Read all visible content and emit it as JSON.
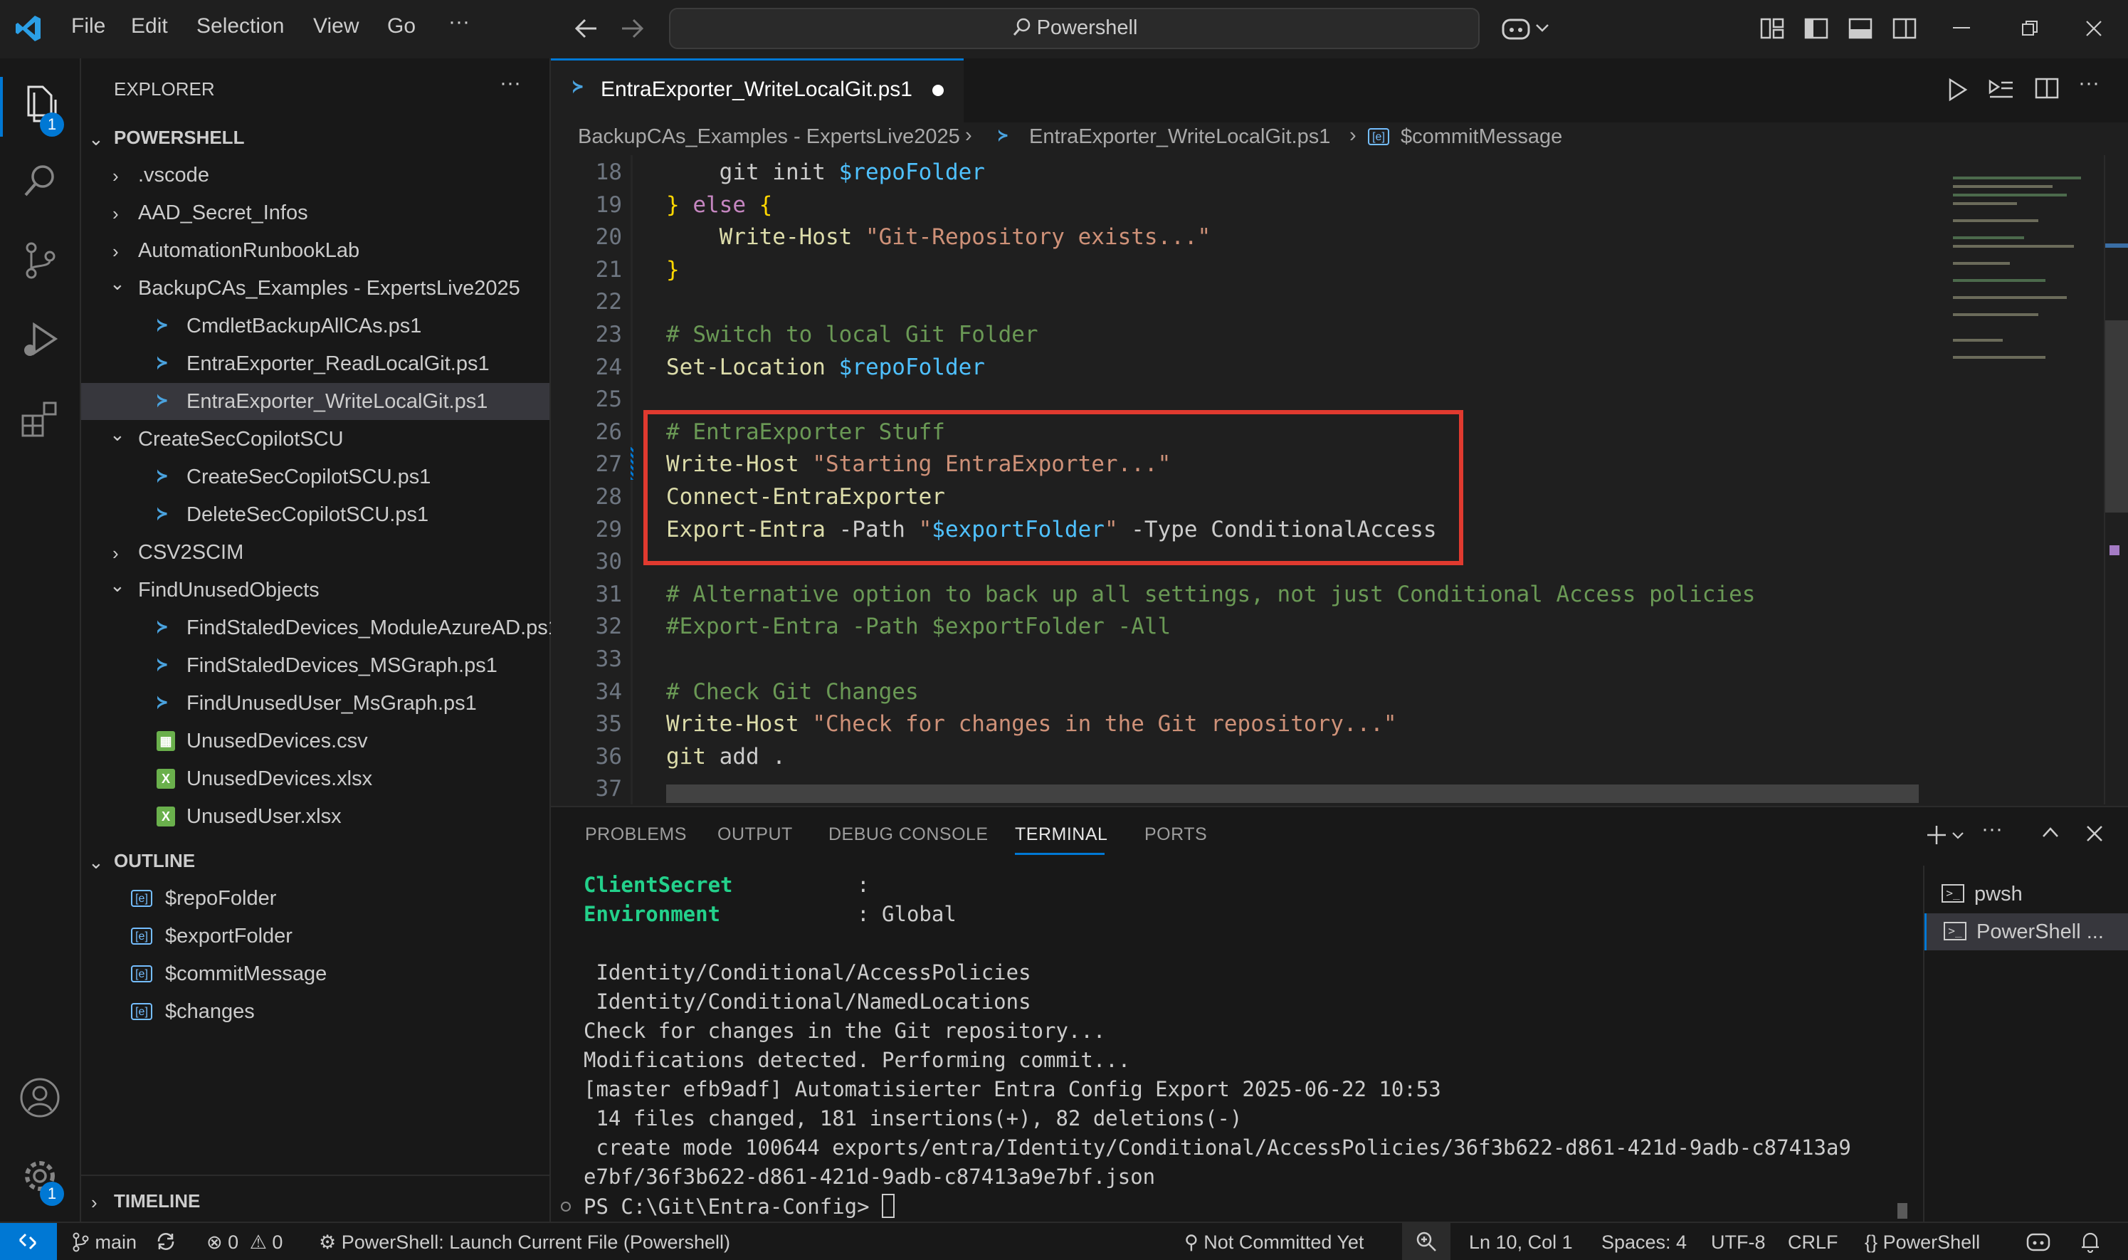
{
  "titlebar": {
    "menu": [
      "File",
      "Edit",
      "Selection",
      "View",
      "Go",
      "···"
    ],
    "search": "Powershell"
  },
  "activity": {
    "explorer_badge": "1",
    "settings_badge": "1"
  },
  "sidebar": {
    "title": "EXPLORER",
    "more": "···",
    "root": "POWERSHELL",
    "items": [
      {
        "label": ".vscode",
        "kind": "folder-closed"
      },
      {
        "label": "AAD_Secret_Infos",
        "kind": "folder-closed"
      },
      {
        "label": "AutomationRunbookLab",
        "kind": "folder-closed"
      },
      {
        "label": "BackupCAs_Examples - ExpertsLive2025",
        "kind": "folder-open"
      },
      {
        "label": "CmdletBackupAllCAs.ps1",
        "kind": "ps"
      },
      {
        "label": "EntraExporter_ReadLocalGit.ps1",
        "kind": "ps"
      },
      {
        "label": "EntraExporter_WriteLocalGit.ps1",
        "kind": "ps"
      },
      {
        "label": "CreateSecCopilotSCU",
        "kind": "folder-open"
      },
      {
        "label": "CreateSecCopilotSCU.ps1",
        "kind": "ps"
      },
      {
        "label": "DeleteSecCopilotSCU.ps1",
        "kind": "ps"
      },
      {
        "label": "CSV2SCIM",
        "kind": "folder-closed"
      },
      {
        "label": "FindUnusedObjects",
        "kind": "folder-open"
      },
      {
        "label": "FindStaledDevices_ModuleAzureAD.ps1",
        "kind": "ps"
      },
      {
        "label": "FindStaledDevices_MSGraph.ps1",
        "kind": "ps"
      },
      {
        "label": "FindUnusedUser_MsGraph.ps1",
        "kind": "ps"
      },
      {
        "label": "UnusedDevices.csv",
        "kind": "csv"
      },
      {
        "label": "UnusedDevices.xlsx",
        "kind": "xlsx"
      },
      {
        "label": "UnusedUser.xlsx",
        "kind": "xlsx"
      }
    ],
    "outline_title": "OUTLINE",
    "outline": [
      "$repoFolder",
      "$exportFolder",
      "$commitMessage",
      "$changes"
    ],
    "timeline_title": "TIMELINE"
  },
  "editor": {
    "tab_label": "EntraExporter_WriteLocalGit.ps1",
    "breadcrumb": [
      "BackupCAs_Examples - ExpertsLive2025",
      "EntraExporter_WriteLocalGit.ps1",
      "$commitMessage"
    ],
    "lines": [
      {
        "n": "18",
        "tokens": [
          [
            "plain",
            "    git init "
          ],
          [
            "var",
            "$repoFolder"
          ]
        ]
      },
      {
        "n": "19",
        "tokens": [
          [
            "brace",
            "}"
          ],
          [
            "kw",
            " else "
          ],
          [
            "brace",
            "{"
          ]
        ]
      },
      {
        "n": "20",
        "tokens": [
          [
            "fn",
            "    Write-Host "
          ],
          [
            "str",
            "\"Git-Repository exists...\""
          ]
        ]
      },
      {
        "n": "21",
        "tokens": [
          [
            "brace",
            "}"
          ]
        ]
      },
      {
        "n": "22",
        "tokens": []
      },
      {
        "n": "23",
        "tokens": [
          [
            "com",
            "# Switch to local Git Folder"
          ]
        ]
      },
      {
        "n": "24",
        "tokens": [
          [
            "fn",
            "Set-Location "
          ],
          [
            "var",
            "$repoFolder"
          ]
        ]
      },
      {
        "n": "25",
        "tokens": []
      },
      {
        "n": "26",
        "tokens": [
          [
            "com",
            "# EntraExporter Stuff"
          ]
        ]
      },
      {
        "n": "27",
        "tokens": [
          [
            "fn",
            "Write-Host "
          ],
          [
            "str",
            "\"Starting EntraExporter...\""
          ]
        ]
      },
      {
        "n": "28",
        "tokens": [
          [
            "fn",
            "Connect-EntraExporter"
          ]
        ]
      },
      {
        "n": "29",
        "tokens": [
          [
            "fn",
            "Export-Entra "
          ],
          [
            "plain",
            "-Path "
          ],
          [
            "str",
            "\""
          ],
          [
            "var",
            "$exportFolder"
          ],
          [
            "str",
            "\""
          ],
          [
            "plain",
            " -Type ConditionalAccess"
          ]
        ]
      },
      {
        "n": "30",
        "tokens": []
      },
      {
        "n": "31",
        "tokens": [
          [
            "com",
            "# Alternative option to back up all settings, not just Conditional Access policies"
          ]
        ]
      },
      {
        "n": "32",
        "tokens": [
          [
            "com",
            "#Export-Entra -Path $exportFolder -All"
          ]
        ]
      },
      {
        "n": "33",
        "tokens": []
      },
      {
        "n": "34",
        "tokens": [
          [
            "com",
            "# Check Git Changes"
          ]
        ]
      },
      {
        "n": "35",
        "tokens": [
          [
            "fn",
            "Write-Host "
          ],
          [
            "str",
            "\"Check for changes in the Git repository...\""
          ]
        ]
      },
      {
        "n": "36",
        "tokens": [
          [
            "fn",
            "git "
          ],
          [
            "plain",
            "add ."
          ]
        ]
      },
      {
        "n": "37",
        "tokens": []
      }
    ]
  },
  "panel": {
    "tabs": [
      "PROBLEMS",
      "OUTPUT",
      "DEBUG CONSOLE",
      "TERMINAL",
      "PORTS"
    ],
    "active_tab": "TERMINAL",
    "terminal_lines": [
      {
        "text": "ClientSecret          :",
        "style": "key"
      },
      {
        "text": "Environment           : Global",
        "style": "key2"
      },
      {
        "text": "",
        "style": "plain"
      },
      {
        "text": " Identity/Conditional/AccessPolicies",
        "style": "plain"
      },
      {
        "text": " Identity/Conditional/NamedLocations",
        "style": "plain"
      },
      {
        "text": "Check for changes in the Git repository...",
        "style": "plain"
      },
      {
        "text": "Modifications detected. Performing commit...",
        "style": "plain"
      },
      {
        "text": "[master efb9adf] Automatisierter Entra Config Export 2025-06-22 10:53",
        "style": "plain"
      },
      {
        "text": " 14 files changed, 181 insertions(+), 82 deletions(-)",
        "style": "plain"
      },
      {
        "text": " create mode 100644 exports/entra/Identity/Conditional/AccessPolicies/36f3b622-d861-421d-9adb-c87413a9",
        "style": "plain"
      },
      {
        "text": "e7bf/36f3b622-d861-421d-9adb-c87413a9e7bf.json",
        "style": "plain"
      },
      {
        "text": "PS C:\\Git\\Entra-Config> ",
        "style": "prompt"
      }
    ],
    "terminals": [
      "pwsh",
      "PowerShell ..."
    ]
  },
  "status": {
    "branch": "main",
    "errors": "0",
    "warnings": "0",
    "launch": "PowerShell: Launch Current File (Powershell)",
    "git_blame": "Not Committed Yet",
    "position": "Ln 10, Col 1",
    "spaces": "Spaces: 4",
    "encoding": "UTF-8",
    "eol": "CRLF",
    "language": "PowerShell"
  },
  "colors": {
    "accent": "#0078d4",
    "highlight_box": "#e03a2f",
    "comment": "#6a9955",
    "string": "#ce9178",
    "function": "#dcdcaa",
    "variable": "#4fc1ff",
    "terminal_key": "#23d18b"
  }
}
